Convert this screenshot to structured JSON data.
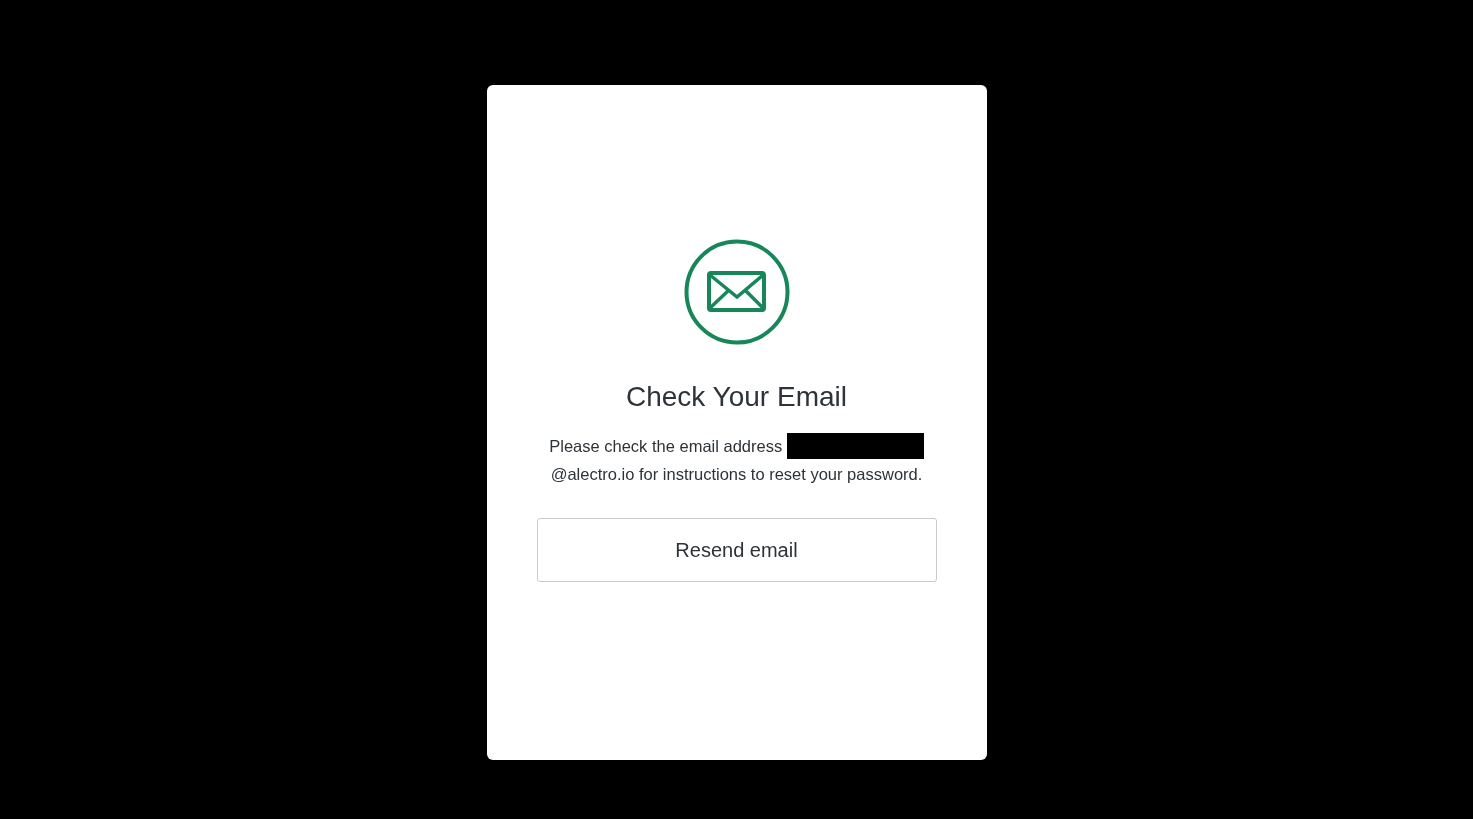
{
  "dialog": {
    "title": "Check Your Email",
    "message": {
      "before": "Please check the email address",
      "redacted": true,
      "after": "@alectro.io for instructions to reset your password."
    },
    "buttons": [
      "Resend email"
    ]
  }
}
